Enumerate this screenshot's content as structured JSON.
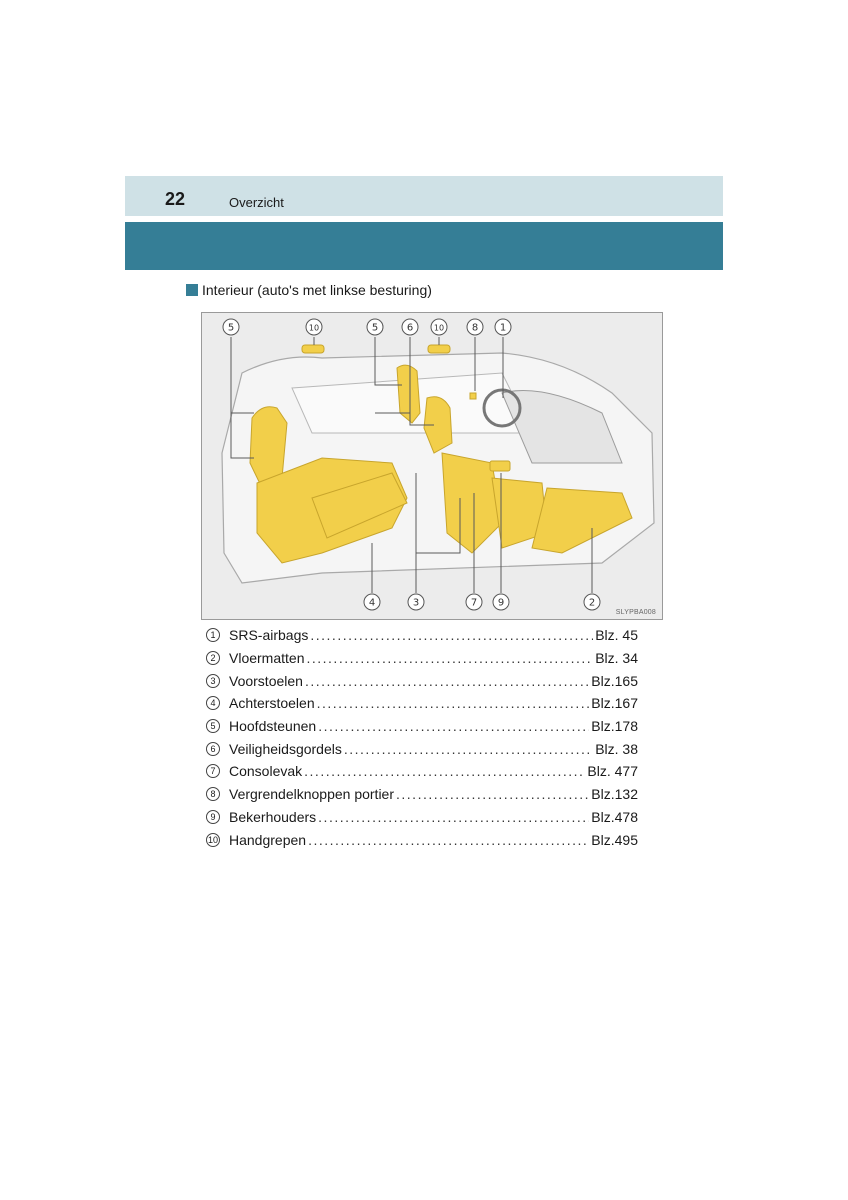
{
  "header": {
    "page_number": "22",
    "section": "Overzicht"
  },
  "subheading": "Interieur (auto's met linkse besturing)",
  "figure": {
    "code": "SLYPBA008",
    "callouts_top": [
      "10",
      "5",
      "6",
      "10",
      "8",
      "1"
    ],
    "callouts_top_first": "5",
    "callouts_bottom": [
      "4",
      "3",
      "7",
      "9",
      "2"
    ],
    "highlight_color": "#f2cf4a",
    "line_color": "#5a5a5a"
  },
  "legend": [
    {
      "num": "1",
      "label": "SRS-airbags",
      "page": "Blz. 45"
    },
    {
      "num": "2",
      "label": "Vloermatten",
      "page": "Blz. 34"
    },
    {
      "num": "3",
      "label": "Voorstoelen",
      "page": "Blz.165"
    },
    {
      "num": "4",
      "label": "Achterstoelen",
      "page": "Blz.167"
    },
    {
      "num": "5",
      "label": "Hoofdsteunen",
      "page": "Blz.178"
    },
    {
      "num": "6",
      "label": "Veiligheidsgordels",
      "page": "Blz. 38"
    },
    {
      "num": "7",
      "label": "Consolevak",
      "page": "Blz. 477"
    },
    {
      "num": "8",
      "label": "Vergrendelknoppen portier",
      "page": "Blz.132"
    },
    {
      "num": "9",
      "label": "Bekerhouders",
      "page": "Blz.478"
    },
    {
      "num": "10",
      "label": "Handgrepen",
      "page": "Blz.495"
    }
  ]
}
